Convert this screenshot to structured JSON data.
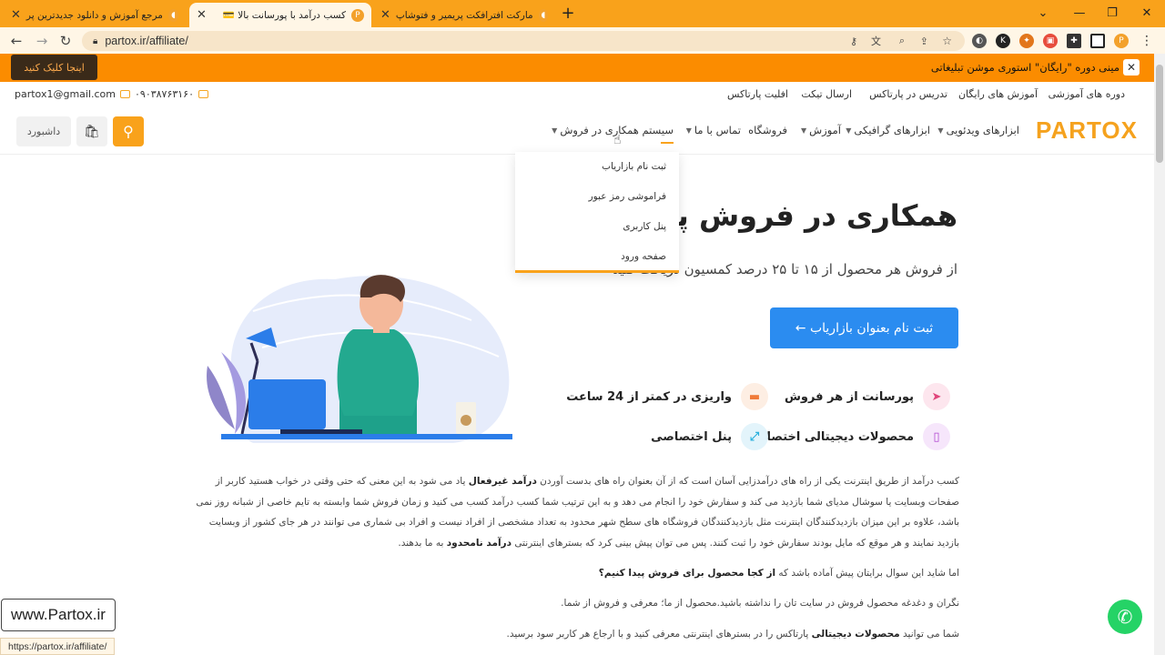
{
  "browser": {
    "tabs": [
      {
        "title": "مرجع آموزش و دانلود جدیدترین پر"
      },
      {
        "title": "کسب درآمد با پورسانت بالا 💳"
      },
      {
        "title": "مارکت افترافکت پریمیر و فتوشاپ"
      }
    ],
    "url": "partox.ir/affiliate/",
    "status_url": "https://partox.ir/affiliate/"
  },
  "promo": {
    "text": "مینی دوره \"رایگان\" استوری موشن تبلیغاتی",
    "button": "اینجا کلیک کنید"
  },
  "topbar": {
    "links": [
      "دوره های آموزشی",
      "آموزش های رایگان",
      "تدریس در پارتاکس",
      "ارسال تیکت",
      "افلیت پارتاکس"
    ],
    "phone": "۰۹۰۳۸۷۶۳۱۶۰",
    "email": "partox1@gmail.com"
  },
  "nav": {
    "logo": "PARTOX",
    "items": [
      "ابزارهای ویدئویی",
      "ابزارهای گرافیکی",
      "آموزش",
      "فروشگاه",
      "تماس با ما",
      "سیستم همکاری در فروش"
    ],
    "dashboard": "داشبورد"
  },
  "dropdown": {
    "items": [
      "ثبت نام بازاریاب",
      "فراموشی رمز عبور",
      "پنل کاربری",
      "صفحه ورود"
    ]
  },
  "hero": {
    "title": "همکاری در فروش پارتاکس",
    "subtitle": "از فروش هر محصول از ۱۵ تا ۲۵ درصد کمسیون دریافت کنید",
    "cta": "ثبت نام بعنوان بازاریاب ←"
  },
  "features": [
    {
      "label": "پورسانت از هر فروش",
      "icon": "send-icon"
    },
    {
      "label": "واریزی در کمتر از 24 ساعت",
      "icon": "wallet-icon"
    },
    {
      "label": "محصولات دیجیتالی اختصاصی",
      "icon": "file-icon"
    },
    {
      "label": "پنل اختصاصی",
      "icon": "expand-icon"
    }
  ],
  "body": {
    "p1_a": "کسب درآمد از طریق اینترنت یکی از راه های درآمدزایی آسان است که از آن بعنوان راه های بدست آوردن ",
    "p1_b": "درآمد غیرفعال",
    "p1_c": " یاد می شود به این معنی که حتی وقتی در خواب هستید کاربر از صفحات وبسایت یا سوشال مدیای شما بازدید می کند و سفارش خود را انجام می دهد و به این ترتیب شما کسب درآمد کسب می کنید و زمان فروش شما وابسته به تایم خاصی از شبانه روز نمی باشد، علاوه بر این میزان بازدیدکنندگان اینترنت مثل بازدیدکنندگان فروشگاه های سطح شهر محدود به تعداد مشخصی از افراد نیست و افراد بی شماری می توانند در هر جای کشور از وبسایت بازدید نمایند و هر موقع که مایل بودند سفارش خود را ثبت کنند. پس می توان پیش بینی کرد که بسترهای اینترنتی ",
    "p1_d": "درآمد نامحدود",
    "p1_e": " به ما بدهند.",
    "p2_a": "اما شاید این سوال برایتان پیش آماده باشد که ",
    "p2_b": "از کجا محصول برای فروش پیدا کنیم؟",
    "p3": "نگران و دغدغه محصول فروش در سایت تان را نداشته باشید.محصول از ما؛ معرفی و فروش از شما.",
    "p4_a": "شما می توانید ",
    "p4_b": "محصولات دیجیتالی",
    "p4_c": " پارتاکس را در بسترهای اینترنتی معرفی کنید و با ارجاع هر کاربر سود برسید."
  },
  "watermark": "www.Partox.ir"
}
